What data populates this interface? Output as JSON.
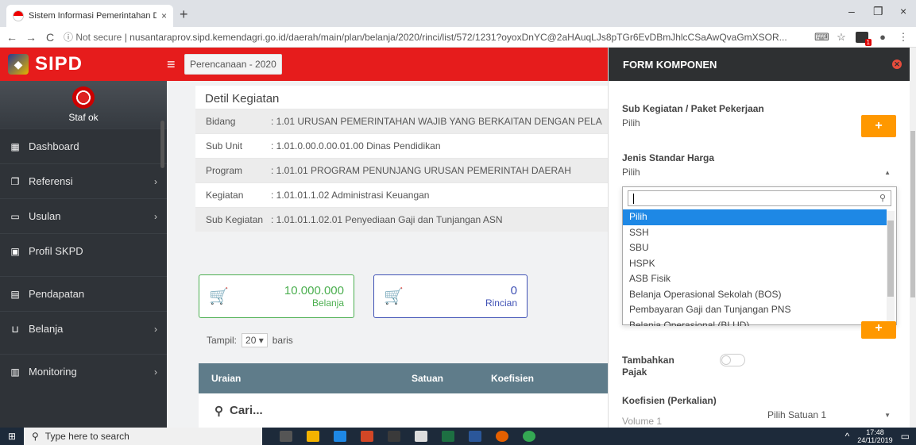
{
  "browser": {
    "tab_title": "Sistem Informasi Pemerintahan D",
    "tab_close": "×",
    "new_tab": "+",
    "win_min": "–",
    "win_max": "❐",
    "win_close": "×",
    "back": "←",
    "forward": "→",
    "reload": "C",
    "security": "ⓘ Not secure",
    "url": "nusantaraprov.sipd.kemendagri.go.id/daerah/main/plan/belanja/2020/rinci/list/572/1231?oyoxDnYC@2aHAuqLJs8pTGr6EvDBmJhlcCSaAwQvaGmXSOR...",
    "translate_icon": "⌨",
    "star_icon": "☆",
    "ext_badge": "1",
    "account_icon": "●",
    "menu_icon": "⋮"
  },
  "app": {
    "brand": "SIPD",
    "logo": "◆",
    "hamburger": "≡",
    "plan_chip": "Perencanaan - 2020"
  },
  "sidebar": {
    "username": "Staf ok",
    "items": [
      {
        "label": "Dashboard",
        "icon": "▦",
        "arrow": ""
      },
      {
        "label": "Referensi",
        "icon": "❐",
        "arrow": "›"
      },
      {
        "label": "Usulan",
        "icon": "▭",
        "arrow": "›"
      },
      {
        "label": "Profil SKPD",
        "icon": "▣",
        "arrow": ""
      },
      {
        "label": "Pendapatan",
        "icon": "▤",
        "arrow": ""
      },
      {
        "label": "Belanja",
        "icon": "⊔",
        "arrow": "›"
      },
      {
        "label": "Monitoring",
        "icon": "▥",
        "arrow": "›"
      }
    ]
  },
  "detail": {
    "title": "Detil Kegiatan",
    "rows": [
      {
        "label": "Bidang",
        "value": ":  1.01 URUSAN PEMERINTAHAN WAJIB YANG BERKAITAN DENGAN PELA"
      },
      {
        "label": "Sub Unit",
        "value": ":  1.01.0.00.0.00.01.00 Dinas Pendidikan"
      },
      {
        "label": "Program",
        "value": ":  1.01.01  PROGRAM PENUNJANG URUSAN PEMERINTAH DAERAH"
      },
      {
        "label": "Kegiatan",
        "value": ":  1.01.01.1.02 Administrasi Keuangan"
      },
      {
        "label": "Sub Kegiatan",
        "value": ":  1.01.01.1.02.01  Penyediaan Gaji dan Tunjangan ASN"
      }
    ]
  },
  "stats": {
    "belanja_value": "10.000.000",
    "belanja_label": "Belanja",
    "rincian_value": "0",
    "rincian_label": "Rincian",
    "cart_icon": "🛒"
  },
  "table": {
    "tampil": "Tampil:",
    "page_size": "20 ▾",
    "baris": "baris",
    "col_uraian": "Uraian",
    "col_satuan": "Satuan",
    "col_koefisien": "Koefisien",
    "search_placeholder": "Cari...",
    "search_icon": "⚲"
  },
  "panel": {
    "title": "FORM KOMPONEN",
    "close_icon": "✕",
    "sub_kegiatan_label": "Sub Kegiatan / Paket Pekerjaan",
    "sub_kegiatan_value": "Pilih",
    "plus": "+",
    "jenis_label": "Jenis Standar Harga",
    "jenis_value": "Pilih",
    "caret_up": "▲",
    "caret_down": "▼",
    "dropdown_options": [
      "Pilih",
      "SSH",
      "SBU",
      "HSPK",
      "ASB Fisik",
      "Belanja Operasional Sekolah (BOS)",
      "Pembayaran Gaji dan Tunjangan PNS",
      "Belanja Operasional (BLUD)"
    ],
    "tambahkan_label": "Tambahkan",
    "pajak_label": "Pajak",
    "koefisien_label": "Koefisien (Perkalian)",
    "volume_label": "Volume 1",
    "satuan_value": "Pilih Satuan 1"
  },
  "taskbar": {
    "start": "⊞",
    "search_placeholder": "Type here to search",
    "time": "17:48",
    "date": "24/11/2019",
    "tray_up": "^",
    "notif": "▭"
  }
}
